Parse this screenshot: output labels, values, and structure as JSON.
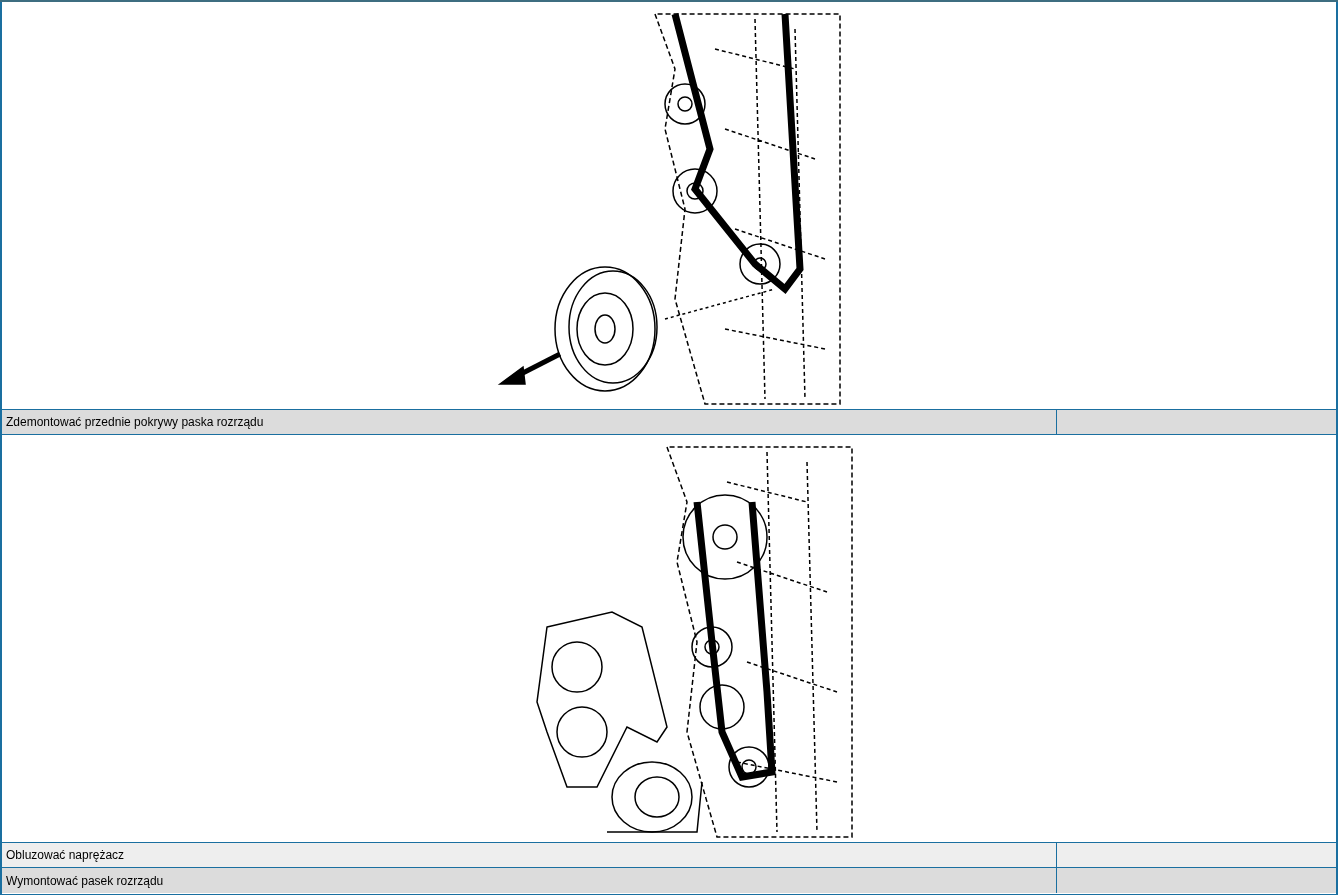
{
  "steps": [
    {
      "kind": "image"
    },
    {
      "kind": "text",
      "label": "Zdemontować przednie pokrywy paska rozrządu"
    },
    {
      "kind": "image"
    },
    {
      "kind": "text",
      "label": "Obluzować naprężacz"
    },
    {
      "kind": "text",
      "label": "Wymontować pasek rozrządu"
    }
  ]
}
